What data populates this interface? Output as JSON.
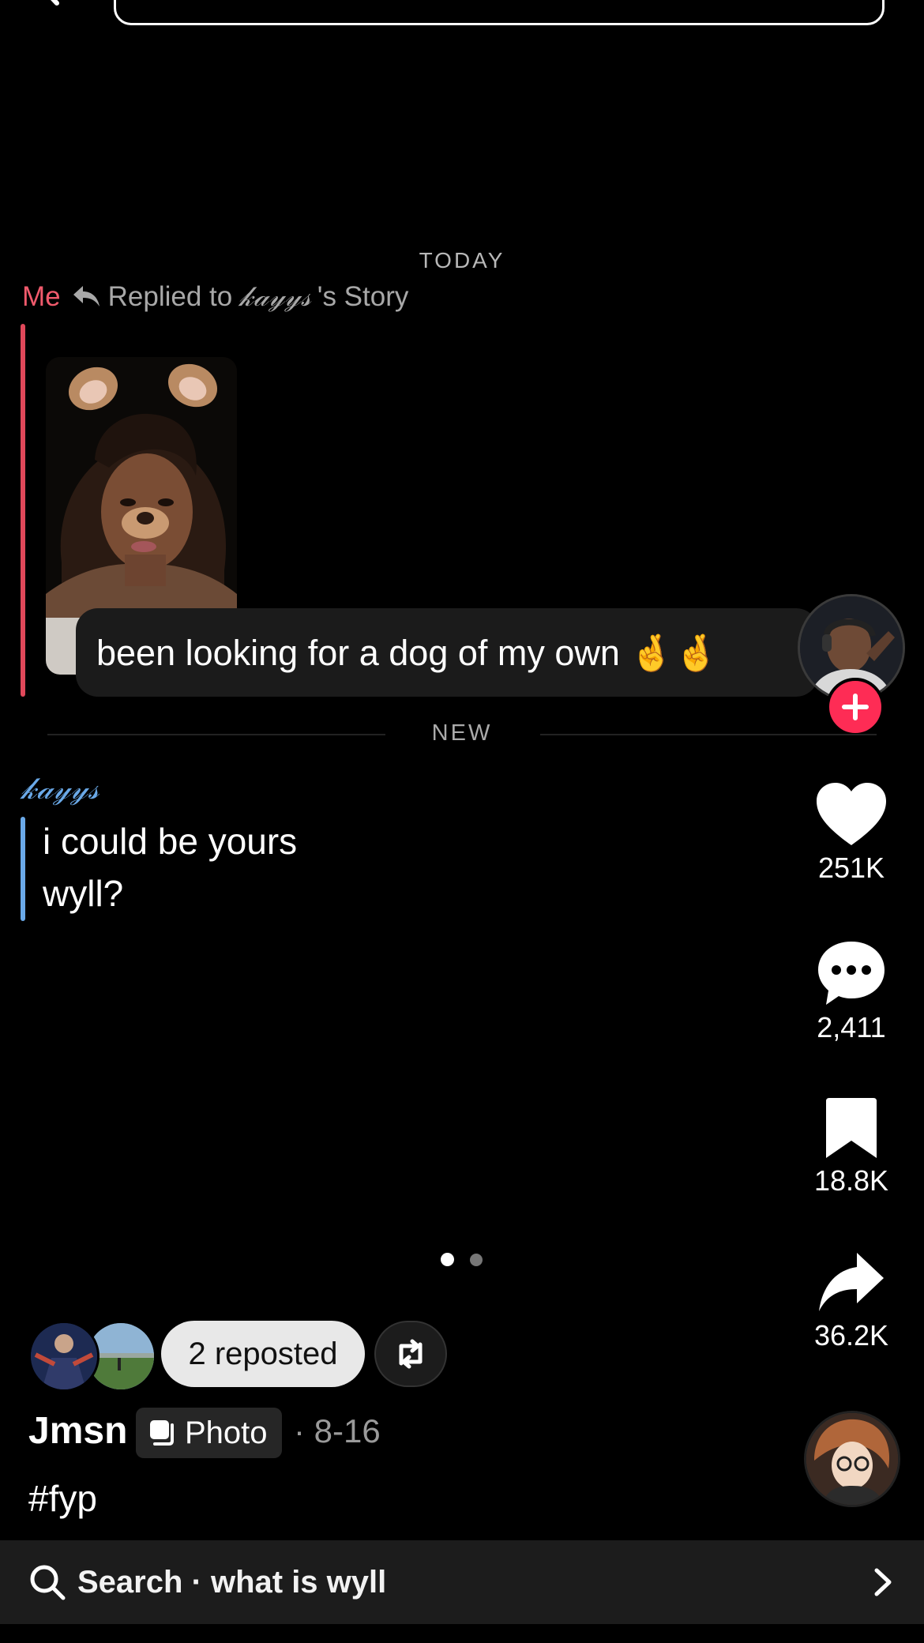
{
  "dm": {
    "date_separator": "TODAY",
    "reply_sender": "Me",
    "reply_prefix": "Replied to",
    "story_owner": "𝓀𝒶𝓎𝓎𝓈",
    "reply_suffix": "'s Story",
    "reply_message": "been looking for a dog of my own 🤞🤞",
    "new_separator": "NEW",
    "sender_name": "𝓀𝒶𝓎𝓎𝓈",
    "message_line1": "i could be yours",
    "message_line2": "wyll?"
  },
  "actions": {
    "like_count": "251K",
    "comment_count": "2,411",
    "bookmark_count": "18.8K",
    "share_count": "36.2K"
  },
  "carousel": {
    "current": 1,
    "total": 2
  },
  "post": {
    "reposted_label": "2 reposted",
    "author": "Jmsn",
    "type_badge": "Photo",
    "date": "· 8-16",
    "caption": "#fyp"
  },
  "bottom_search": {
    "label": "Search · what is wyll"
  },
  "colors": {
    "background": "#000000",
    "me_label": "#f05a6c",
    "reply_bar": "#e0485a",
    "sender_accent": "#6aa9e8",
    "follow_button": "#fe2c55",
    "bubble": "#1b1b1b",
    "search_bar": "#1c1c1c"
  },
  "icons": {
    "back": "chevron-left-icon",
    "reply": "reply-arrow-icon",
    "follow": "plus-icon",
    "like": "heart-icon",
    "comment": "speech-bubble-icon",
    "bookmark": "bookmark-icon",
    "share": "share-arrow-icon",
    "repost": "repost-icon",
    "photo": "photo-stack-icon",
    "search": "search-icon",
    "chevron": "chevron-right-icon"
  }
}
